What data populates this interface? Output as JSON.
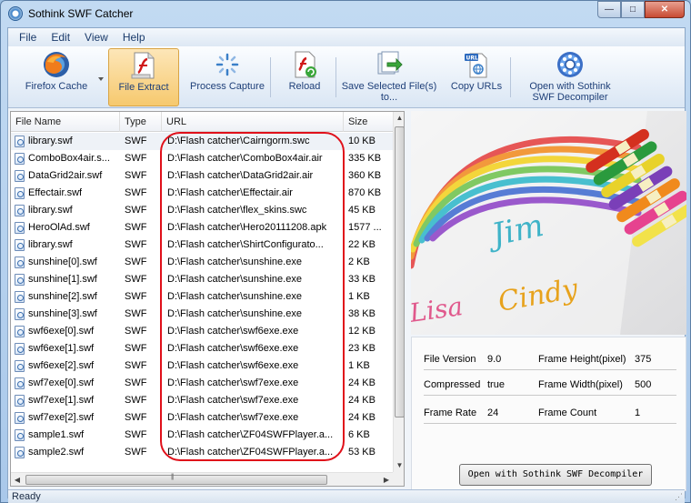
{
  "window": {
    "title": "Sothink SWF Catcher"
  },
  "controls": {
    "minimize": "—",
    "maximize": "□",
    "close": "✕"
  },
  "menu": [
    "File",
    "Edit",
    "View",
    "Help"
  ],
  "toolbar": [
    {
      "label": "Firefox Cache",
      "icon": "firefox-icon"
    },
    {
      "label": "File Extract",
      "icon": "file-extract-icon",
      "active": true
    },
    {
      "label": "Process Capture",
      "icon": "process-capture-icon"
    },
    {
      "label": "Reload",
      "icon": "reload-icon"
    },
    {
      "label": "Save Selected File(s)",
      "label2": "to...",
      "icon": "save-icon"
    },
    {
      "label": "Copy URLs",
      "icon": "copy-urls-icon"
    },
    {
      "label": "Open with Sothink",
      "label2": "SWF Decompiler",
      "icon": "decompiler-icon"
    }
  ],
  "columns": [
    "File Name",
    "Type",
    "URL",
    "Size"
  ],
  "files": [
    {
      "name": "library.swf",
      "type": "SWF",
      "url": "D:\\Flash catcher\\Cairngorm.swc",
      "size": "10 KB"
    },
    {
      "name": "ComboBox4air.s...",
      "type": "SWF",
      "url": "D:\\Flash catcher\\ComboBox4air.air",
      "size": "335 KB"
    },
    {
      "name": "DataGrid2air.swf",
      "type": "SWF",
      "url": "D:\\Flash catcher\\DataGrid2air.air",
      "size": "360 KB"
    },
    {
      "name": "Effectair.swf",
      "type": "SWF",
      "url": "D:\\Flash catcher\\Effectair.air",
      "size": "870 KB"
    },
    {
      "name": "library.swf",
      "type": "SWF",
      "url": "D:\\Flash catcher\\flex_skins.swc",
      "size": "45 KB"
    },
    {
      "name": "HeroOlAd.swf",
      "type": "SWF",
      "url": "D:\\Flash catcher\\Hero20111208.apk",
      "size": "1577 ..."
    },
    {
      "name": "library.swf",
      "type": "SWF",
      "url": "D:\\Flash catcher\\ShirtConfigurato...",
      "size": "22 KB"
    },
    {
      "name": "sunshine[0].swf",
      "type": "SWF",
      "url": "D:\\Flash catcher\\sunshine.exe",
      "size": "2 KB"
    },
    {
      "name": "sunshine[1].swf",
      "type": "SWF",
      "url": "D:\\Flash catcher\\sunshine.exe",
      "size": "33 KB"
    },
    {
      "name": "sunshine[2].swf",
      "type": "SWF",
      "url": "D:\\Flash catcher\\sunshine.exe",
      "size": "1 KB"
    },
    {
      "name": "sunshine[3].swf",
      "type": "SWF",
      "url": "D:\\Flash catcher\\sunshine.exe",
      "size": "38 KB"
    },
    {
      "name": "swf6exe[0].swf",
      "type": "SWF",
      "url": "D:\\Flash catcher\\swf6exe.exe",
      "size": "12 KB"
    },
    {
      "name": "swf6exe[1].swf",
      "type": "SWF",
      "url": "D:\\Flash catcher\\swf6exe.exe",
      "size": "23 KB"
    },
    {
      "name": "swf6exe[2].swf",
      "type": "SWF",
      "url": "D:\\Flash catcher\\swf6exe.exe",
      "size": "1 KB"
    },
    {
      "name": "swf7exe[0].swf",
      "type": "SWF",
      "url": "D:\\Flash catcher\\swf7exe.exe",
      "size": "24 KB"
    },
    {
      "name": "swf7exe[1].swf",
      "type": "SWF",
      "url": "D:\\Flash catcher\\swf7exe.exe",
      "size": "24 KB"
    },
    {
      "name": "swf7exe[2].swf",
      "type": "SWF",
      "url": "D:\\Flash catcher\\swf7exe.exe",
      "size": "24 KB"
    },
    {
      "name": "sample1.swf",
      "type": "SWF",
      "url": "D:\\Flash catcher\\ZF04SWFPlayer.a...",
      "size": "6 KB"
    },
    {
      "name": "sample2.swf",
      "type": "SWF",
      "url": "D:\\Flash catcher\\ZF04SWFPlayer.a...",
      "size": "53 KB"
    }
  ],
  "preview": {
    "words": [
      "Jim",
      "Lisa",
      "Cindy"
    ]
  },
  "info": {
    "file_version_label": "File Version",
    "file_version": "9.0",
    "frame_height_label": "Frame Height(pixel)",
    "frame_height": "375",
    "compressed_label": "Compressed",
    "compressed": "true",
    "frame_width_label": "Frame Width(pixel)",
    "frame_width": "500",
    "frame_rate_label": "Frame Rate",
    "frame_rate": "24",
    "frame_count_label": "Frame Count",
    "frame_count": "1",
    "open_button": "Open with Sothink SWF Decompiler"
  },
  "status": {
    "text": "Ready"
  },
  "colors": {
    "highlight": "#e0101a",
    "toolbar_text": "#1e3f78",
    "active_button": "#f6c96e"
  }
}
